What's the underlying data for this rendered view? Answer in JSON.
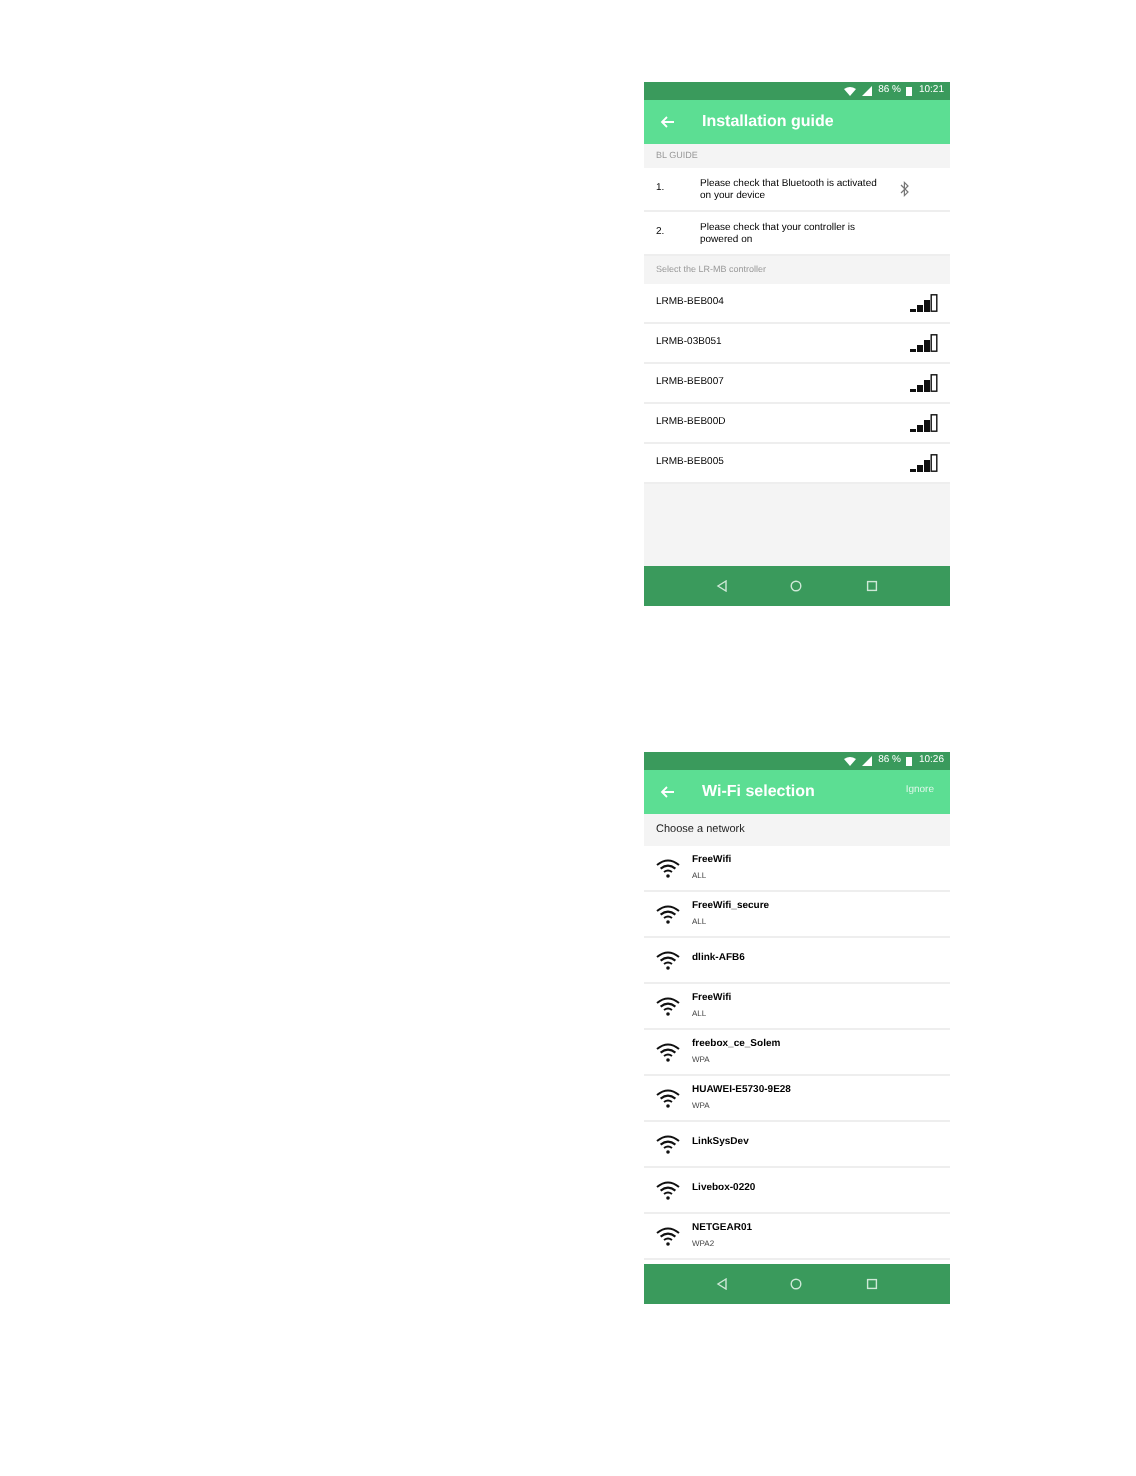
{
  "screens": [
    {
      "kind": "guide",
      "status": {
        "battery": "86 %",
        "time": "10:21"
      },
      "title": "Installation guide",
      "section": "BL GUIDE",
      "steps": [
        {
          "number": "1.",
          "text": "Please check that Bluetooth is activated on your device"
        },
        {
          "number": "2.",
          "text": "Please check that your controller is powered on"
        }
      ],
      "list_label": "Select the LR-MB controller",
      "devices": [
        "LRMB-BEB004",
        "LRMB-03B051",
        "LRMB-BEB007",
        "LRMB-BEB00D",
        "LRMB-BEB005"
      ]
    },
    {
      "kind": "wifi",
      "status": {
        "battery": "86 %",
        "time": "10:26"
      },
      "title": "Wi-Fi selection",
      "action": "Ignore",
      "list_label": "Choose a network",
      "networks": [
        {
          "name": "FreeWifi",
          "security": "ALL"
        },
        {
          "name": "FreeWifi_secure",
          "security": "ALL"
        },
        {
          "name": "dlink-AFB6"
        },
        {
          "name": "FreeWifi",
          "security": "ALL"
        },
        {
          "name": "freebox_ce_Solem",
          "security": "WPA"
        },
        {
          "name": "HUAWEI-E5730-9E28",
          "security": "WPA"
        },
        {
          "name": "LinkSysDev"
        },
        {
          "name": "Livebox-0220"
        },
        {
          "name": "NETGEAR01",
          "security": "WPA2"
        }
      ]
    }
  ]
}
